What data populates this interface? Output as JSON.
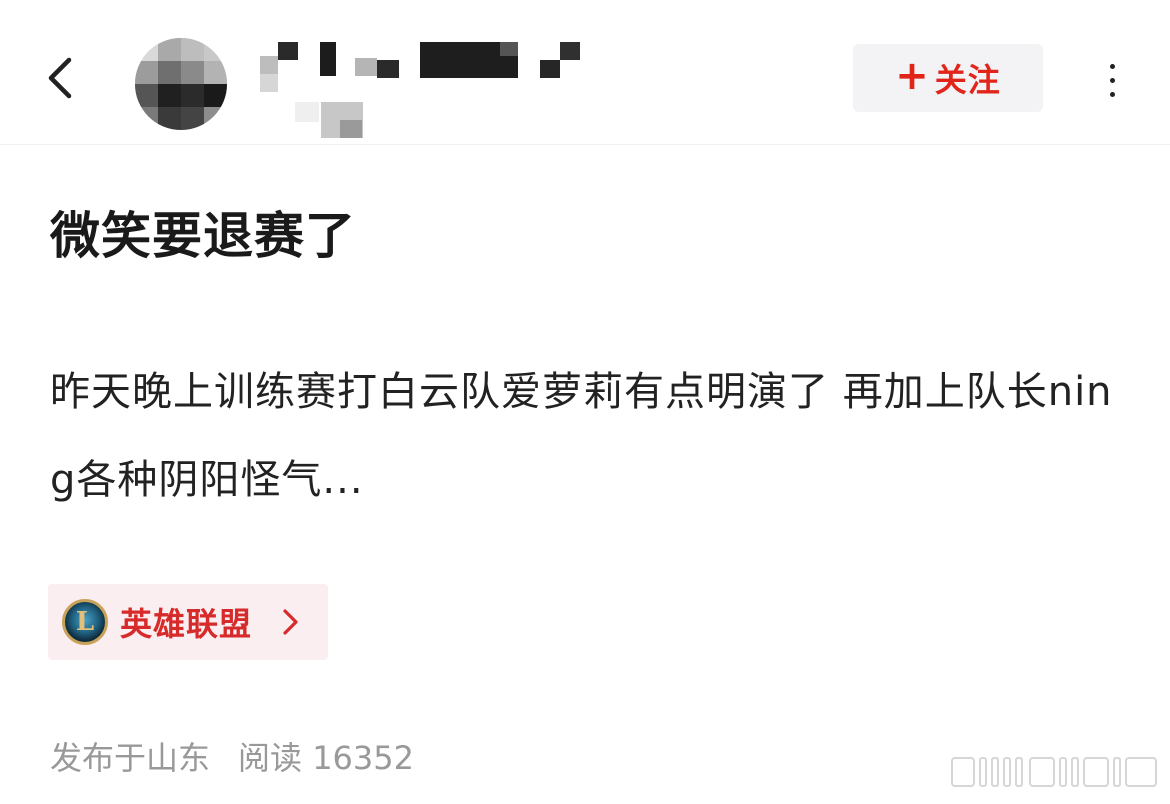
{
  "header": {
    "back_icon": "chevron-left-icon",
    "follow_label": "关注",
    "follow_plus": "+",
    "more_icon": "more-vertical-icon"
  },
  "post": {
    "title": "微笑要退赛了",
    "body": "昨天晚上训练赛打白云队爱萝莉有点明演了 再加上队长ning各种阴阳怪气...",
    "topic": {
      "label": "英雄联盟",
      "logo_letter": "L",
      "icon": "league-of-legends-logo",
      "chevron": "chevron-right-icon"
    },
    "meta": {
      "location": "发布于山东",
      "reads": "阅读 16352"
    }
  },
  "colors": {
    "accent": "#e1251b",
    "topic_bg": "#fbeef0",
    "topic_text": "#d72b2b",
    "meta_text": "#999999"
  }
}
